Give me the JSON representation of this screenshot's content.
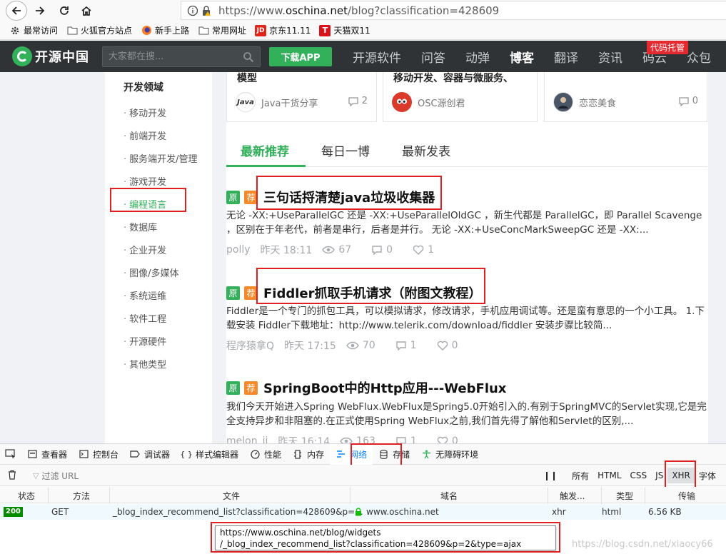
{
  "browser": {
    "url_prefix": "https://www.",
    "url_host": "oschina.net",
    "url_path": "/blog?classification=428609"
  },
  "bookmarks": [
    {
      "label": "最常访问",
      "icon": "gear-icon"
    },
    {
      "label": "火狐官方站点",
      "icon": "folder-icon"
    },
    {
      "label": "新手上路",
      "icon": "firefox-icon"
    },
    {
      "label": "常用网址",
      "icon": "folder-icon"
    },
    {
      "label": "京东11.11",
      "icon": "jd-icon"
    },
    {
      "label": "天猫双11",
      "icon": "tmall-icon"
    }
  ],
  "site": {
    "logo_text": "开源中国",
    "search_placeholder": "大家都在搜...",
    "download_label": "下载APP",
    "nav": [
      "开源软件",
      "问答",
      "动弹",
      "博客",
      "翻译",
      "资讯",
      "码云",
      "众包"
    ],
    "nav_active": "博客",
    "badge": "代码托管"
  },
  "sidebar": {
    "title": "开发领域",
    "items": [
      "移动开发",
      "前端开发",
      "服务端开发/管理",
      "游戏开发",
      "编程语言",
      "数据库",
      "企业开发",
      "图像/多媒体",
      "系统运维",
      "软件工程",
      "开源硬件",
      "其他类型"
    ],
    "active_index": 4
  },
  "cards": [
    {
      "title": "模型",
      "author": "Java干货分享",
      "avatar": "Java",
      "comments": "2"
    },
    {
      "title": "移动开发、容器与微服务、",
      "author": "OSC源创君",
      "avatar": "",
      "comments": ""
    },
    {
      "title": "",
      "author": "恋恋美食",
      "avatar": "",
      "comments": "0"
    }
  ],
  "tabs": [
    "最新推荐",
    "每日一博",
    "最新发表"
  ],
  "articles": [
    {
      "tag_original": "原",
      "tag_recommend": "荐",
      "title": "三句话捋清楚java垃圾收集器",
      "desc": "无论 -XX:+UseParallelGC 还是 -XX:+UseParallelOldGC ，新生代都是 ParallelGC，即 Parallel Scavenge ，区别在于年老代，前者是串行，后者是并行。 无论 -XX:+UseConcMarkSweepGC 还是 -XX:...",
      "author": "polly",
      "time": "昨天 18:11",
      "views": "67",
      "comments": "0",
      "likes": "1"
    },
    {
      "tag_original": "原",
      "tag_recommend": "荐",
      "title": "Fiddler抓取手机请求（附图文教程）",
      "desc": "Fiddler是一个专门的抓包工具，可以模拟请求，修改请求，手机应用调试等。还是蛮有意思的一个小工具。 1.下载安装 Fiddler下载地址：http://www.telerik.com/download/fiddler 安装步骤比较简...",
      "author": "程序猿拿Q",
      "time": "昨天 17:15",
      "views": "70",
      "comments": "1",
      "likes": "0"
    },
    {
      "tag_original": "原",
      "tag_recommend": "荐",
      "title": "SpringBoot中的Http应用---WebFlux",
      "desc": "我们今天开始进入Spring WebFlux.WebFlux是Spring5.0开始引入的.有别于SpringMVC的Servlet实现,它是完全支持异步和非阻塞的.在正式使用Spring WebFlux之前,我们首先得了解他和Servlet的区别,...",
      "author": "melon_jj",
      "time": "昨天 16:14",
      "views": "163",
      "comments": "1",
      "likes": "0"
    }
  ],
  "devtools": {
    "tabs": [
      "查看器",
      "控制台",
      "调试器",
      "样式编辑器",
      "性能",
      "内存",
      "网络",
      "存储",
      "无障碍环境"
    ],
    "active_tab": "网络",
    "filter_placeholder": "过滤 URL",
    "type_filters": [
      "所有",
      "HTML",
      "CSS",
      "JS",
      "XHR",
      "字体"
    ],
    "active_type": "XHR",
    "columns": [
      "状态",
      "方法",
      "文件",
      "域名",
      "触发...",
      "类型",
      "传输"
    ],
    "request": {
      "status": "200",
      "method": "GET",
      "file": "_blog_index_recommend_list?classification=428609&p=...",
      "domain": "www.oschina.net",
      "cause": "xhr",
      "type": "html",
      "transferred": "6.56 KB"
    },
    "tooltip_line1": "https://www.oschina.net/blog/widgets",
    "tooltip_line2": "/_blog_index_recommend_list?classification=428609&p=2&type=ajax"
  },
  "watermark": "https://blog.csdn.net/xiaocy66",
  "colors": {
    "brand_green": "#32b05a",
    "header_dark": "#2f3336",
    "highlight_red": "#e02020",
    "recommend_orange": "#f58a2b"
  }
}
